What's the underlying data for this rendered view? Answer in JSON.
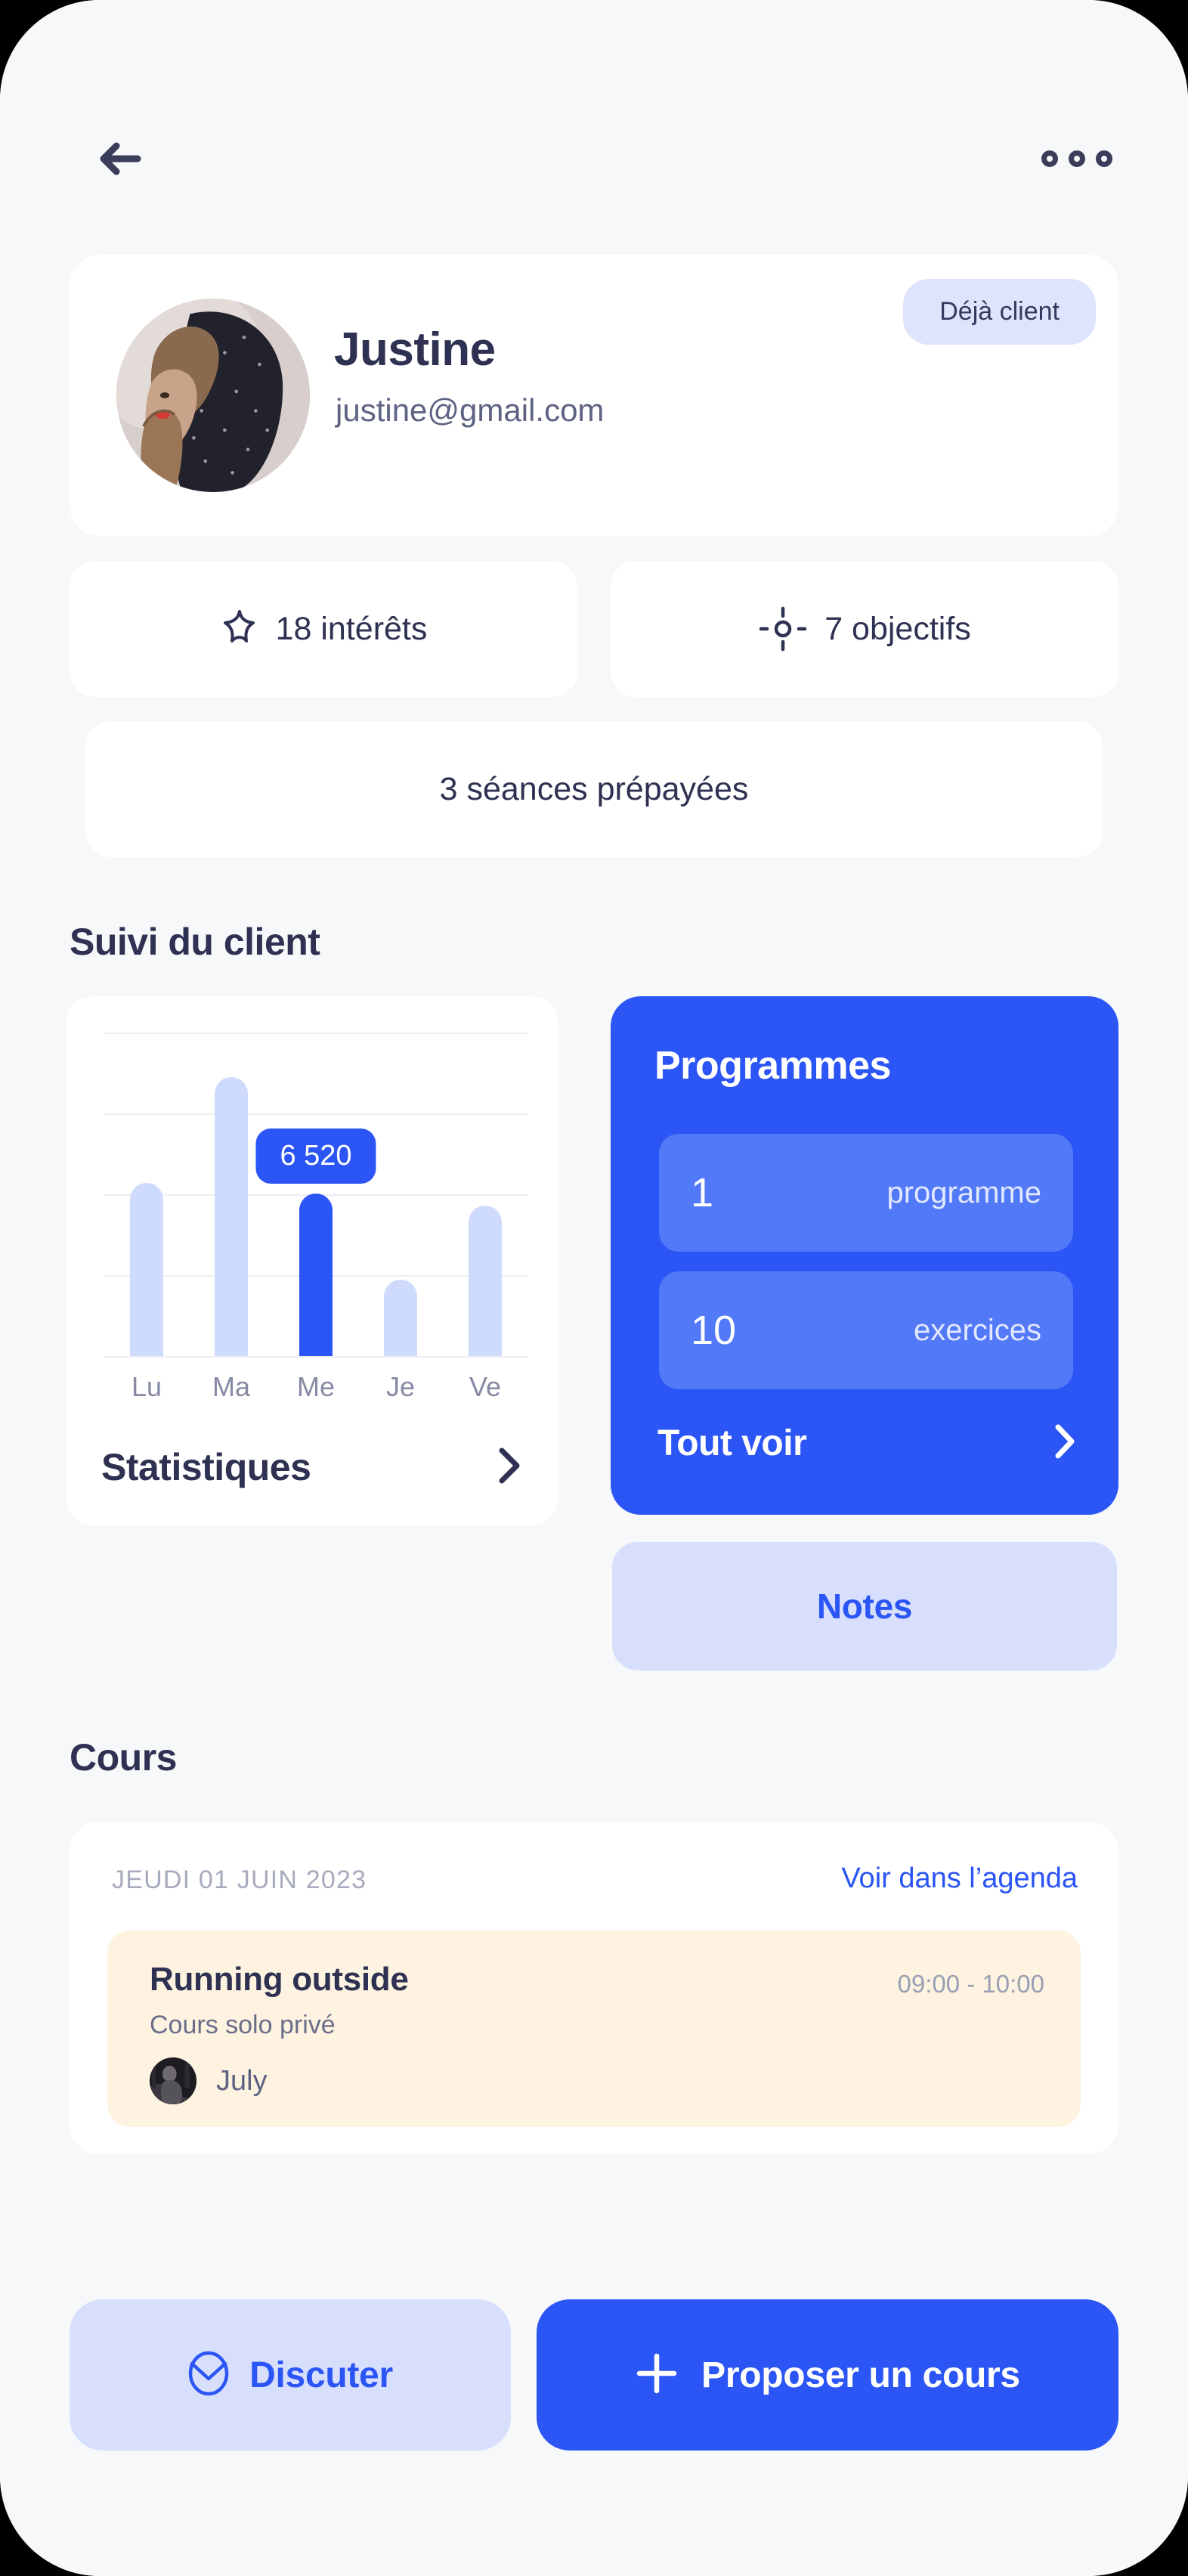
{
  "header": {
    "back_icon": "arrow-left-icon",
    "more_icon": "more-horizontal-icon"
  },
  "profile": {
    "name": "Justine",
    "email": "justine@gmail.com",
    "badge": "Déjà client",
    "avatar_icon": "user-avatar"
  },
  "stats_pills": [
    {
      "icon": "star-outline-icon",
      "label": "18 intérêts"
    },
    {
      "icon": "target-icon",
      "label": "7 objectifs"
    },
    {
      "icon": "",
      "label": "3 séances prépayées"
    }
  ],
  "sections": {
    "tracking_title": "Suivi du client",
    "courses_title": "Cours"
  },
  "stats_card": {
    "footer_label": "Statistiques",
    "chevron_icon": "chevron-right-icon"
  },
  "chart_data": {
    "type": "bar",
    "title": "",
    "xlabel": "",
    "ylabel": "",
    "categories": [
      "Lu",
      "Ma",
      "Me",
      "Je",
      "Ve"
    ],
    "values": [
      6960,
      11200,
      6520,
      3080,
      6040
    ],
    "ylim": [
      0,
      13000
    ],
    "gridlines": [
      0,
      3250,
      6500,
      9750,
      13000
    ],
    "grid": true,
    "legend": "none",
    "highlight_index": 2,
    "highlight_label": "6 520",
    "colors": {
      "bar": "#CFDBFD",
      "bar_active": "#2B55F5",
      "grid": "#ECEEF3",
      "tick_label": "#868AA3"
    }
  },
  "programmes": {
    "title": "Programmes",
    "rows": [
      {
        "value": "1",
        "label": "programme"
      },
      {
        "value": "10",
        "label": "exercices"
      }
    ],
    "link_label": "Tout voir",
    "chevron_icon": "chevron-right-icon"
  },
  "notes": {
    "label": "Notes"
  },
  "courses": {
    "date": "JEUDI 01 JUIN 2023",
    "agenda_link": "Voir dans l’agenda",
    "lesson": {
      "title": "Running outside",
      "subtitle": "Cours solo privé",
      "time": "09:00 - 10:00",
      "coach": "July",
      "coach_avatar_icon": "coach-avatar"
    }
  },
  "actions": {
    "discuter_label": "Discuter",
    "discuter_icon": "chat-bubble-icon",
    "proposer_label": "Proposer un cours",
    "proposer_icon": "plus-icon"
  },
  "colors": {
    "brand_blue": "#2B55F5",
    "brand_blue_soft": "#D7DFFD",
    "bar_muted": "#CFDBFD",
    "ink": "#2E3151",
    "page_bg": "#F7F8FA",
    "card_bg": "#FFFFFF",
    "lesson_bg": "#FDF3E0"
  }
}
